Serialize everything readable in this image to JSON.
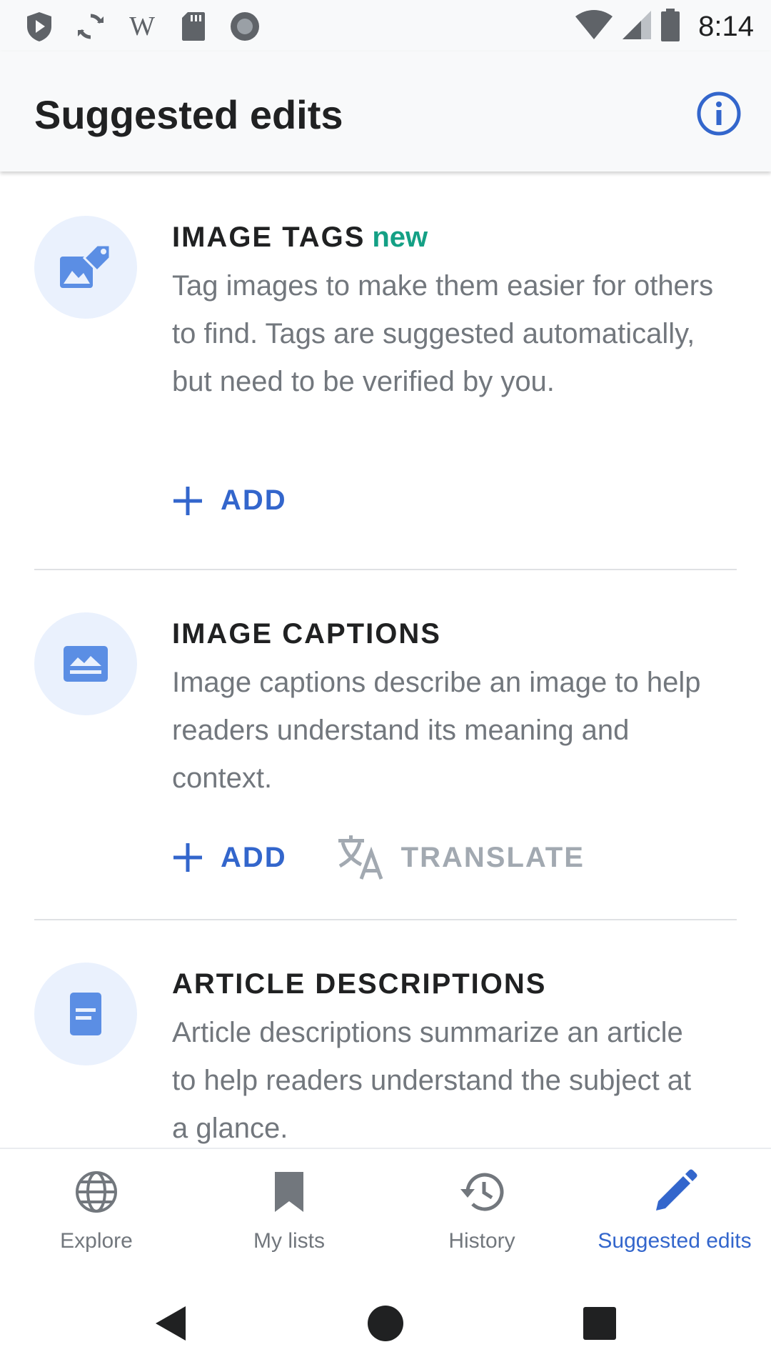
{
  "status_bar": {
    "time": "8:14",
    "left_icons": [
      "shield-play-icon",
      "sync-icon",
      "wikipedia-w-icon",
      "sd-card-icon",
      "record-icon"
    ],
    "right_icons": [
      "wifi-icon",
      "signal-icon",
      "battery-icon"
    ]
  },
  "app_bar": {
    "title": "Suggested edits",
    "info_icon": "info-icon"
  },
  "cards": [
    {
      "icon": "image-tag-icon",
      "title": "IMAGE TAGS",
      "badge": "new",
      "description": "Tag images to make them easier for others to find. Tags are suggested automatically, but need to be verified by you.",
      "actions": [
        {
          "label": "ADD",
          "icon": "plus-icon",
          "enabled": true
        }
      ]
    },
    {
      "icon": "image-caption-icon",
      "title": "IMAGE CAPTIONS",
      "badge": "",
      "description": "Image captions describe an image to help readers understand its meaning and context.",
      "actions": [
        {
          "label": "ADD",
          "icon": "plus-icon",
          "enabled": true
        },
        {
          "label": "TRANSLATE",
          "icon": "translate-icon",
          "enabled": false
        }
      ]
    },
    {
      "icon": "article-description-icon",
      "title": "ARTICLE DESCRIPTIONS",
      "badge": "",
      "description": "Article descriptions summarize an article to help readers understand the subject at a glance.",
      "actions": []
    }
  ],
  "bottom_nav": {
    "items": [
      {
        "label": "Explore",
        "icon": "globe-icon",
        "active": false
      },
      {
        "label": "My lists",
        "icon": "bookmark-icon",
        "active": false
      },
      {
        "label": "History",
        "icon": "history-icon",
        "active": false
      },
      {
        "label": "Suggested edits",
        "icon": "pencil-icon",
        "active": true
      }
    ]
  },
  "system_nav": {
    "buttons": [
      "back-icon",
      "home-icon",
      "recents-icon"
    ]
  },
  "colors": {
    "accent": "#3366cc",
    "new_badge": "#14a085",
    "muted_text": "#72777d",
    "disabled": "#a2a9b1",
    "icon_circle": "#eaf1fd"
  }
}
